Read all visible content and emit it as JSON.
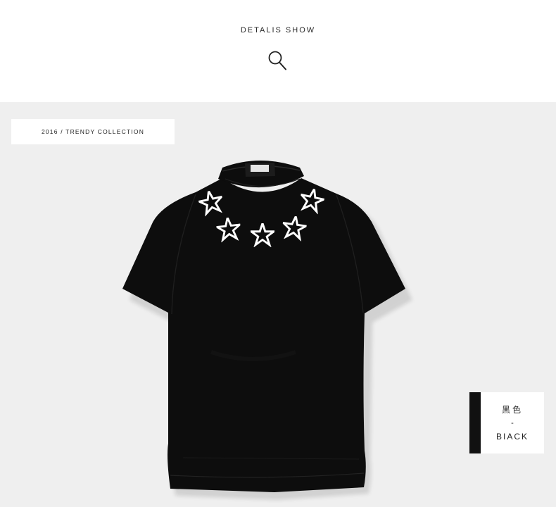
{
  "header": {
    "title": "DETALIS SHOW",
    "icon": "search-icon"
  },
  "photo": {
    "collection_label": "2016 / TRENDY COLLECTION",
    "product": {
      "garment": "t-shirt",
      "garment_color": "#0d0d0d",
      "print_color": "#ffffff",
      "print_graphic": "five-star-necklace"
    },
    "color_tag": {
      "name_cn": "黑色",
      "separator": "-",
      "name_en": "BIACK",
      "swatch_color": "#111111"
    }
  }
}
